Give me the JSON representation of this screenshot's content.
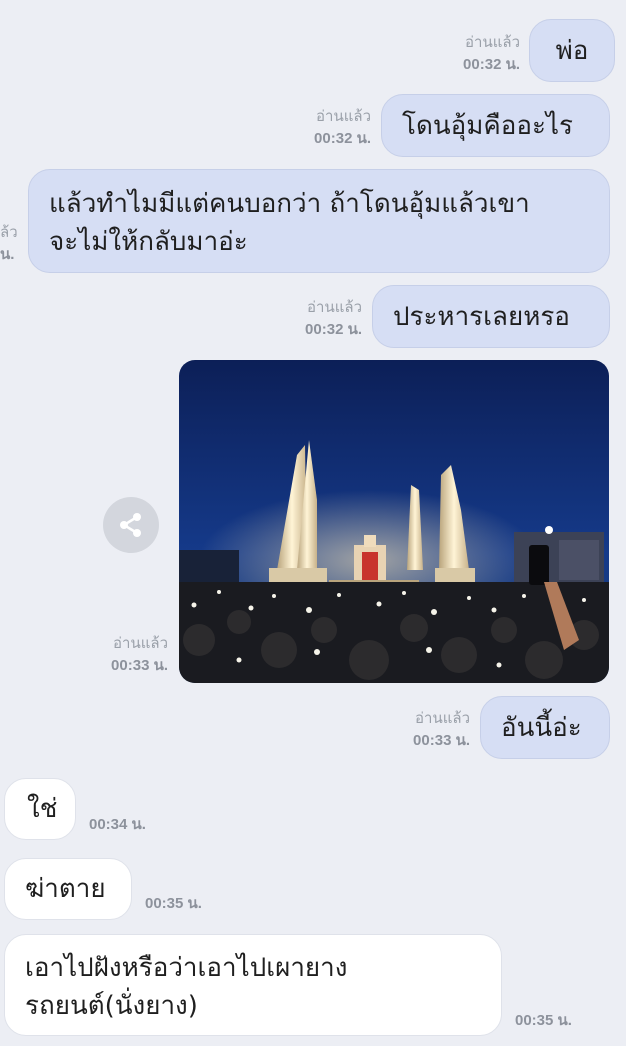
{
  "messages": [
    {
      "text": "พ่อ",
      "read": "อ่านแล้ว",
      "time": "00:32 น."
    },
    {
      "text": "โดนอุ้มคืออะไร",
      "read": "อ่านแล้ว",
      "time": "00:32 น."
    },
    {
      "line1": "แล้วทำไมมีแต่คนบอกว่า ถ้าโดนอุ้มแล้วเขา",
      "line2": "จะไม่ให้กลับมาอ่ะ",
      "read": "ล้ว",
      "time": "น."
    },
    {
      "text": "ประหารเลยหรอ",
      "read": "อ่านแล้ว",
      "time": "00:32 น."
    },
    {
      "image": "democracy-monument-night-photo",
      "read": "อ่านแล้ว",
      "time": "00:33 น."
    },
    {
      "text": "อันนี้อ่ะ",
      "read": "อ่านแล้ว",
      "time": "00:33 น."
    },
    {
      "text": "ใช่",
      "time": "00:34 น."
    },
    {
      "text": "ฆ่าตาย",
      "time": "00:35 น."
    },
    {
      "line1": "เอาไปฝังหรือว่าเอาไปเผายาง",
      "line2": "รถยนต์(นั่งยาง)",
      "time": "00:35 น."
    }
  ],
  "icons": {
    "share": "share-icon"
  },
  "colors": {
    "background": "#eceef4",
    "outgoing_bubble": "#d6def4",
    "incoming_bubble": "#ffffff",
    "meta_text": "#8d929c"
  }
}
